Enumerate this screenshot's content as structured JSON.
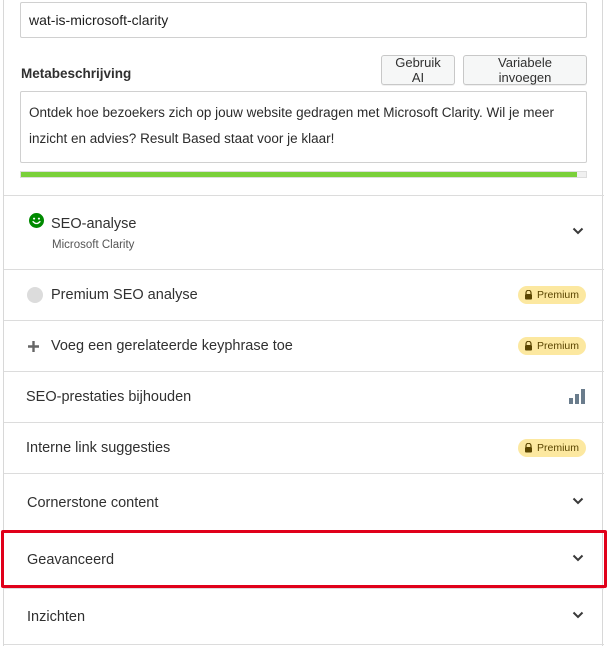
{
  "slug": {
    "value": "wat-is-microsoft-clarity"
  },
  "meta": {
    "label": "Metabeschrijving",
    "use_ai_button": "Gebruik AI",
    "insert_variable_button": "Variabele invoegen",
    "description": "Ontdek hoe bezoekers zich op jouw website gedragen met Microsoft Clarity. Wil je meer inzicht en advies? Result Based staat voor je klaar!",
    "length_progress": 0.984
  },
  "sections": {
    "seo_analysis": {
      "title": "SEO-analyse",
      "subtitle": "Microsoft Clarity",
      "status_icon": "smiley-icon",
      "status_color": "#008a00"
    },
    "premium_seo": {
      "title": "Premium SEO analyse",
      "badge": "Premium"
    },
    "related_keyphrase": {
      "title": "Voeg een gerelateerde keyphrase toe",
      "badge": "Premium"
    },
    "seo_performance": {
      "title": "SEO-prestaties bijhouden",
      "icon": "bar-chart-icon"
    },
    "internal_links": {
      "title": "Interne link suggesties",
      "badge": "Premium"
    },
    "cornerstone": {
      "title": "Cornerstone content"
    },
    "advanced": {
      "title": "Geavanceerd"
    },
    "insights": {
      "title": "Inzichten"
    }
  },
  "colors": {
    "progress": "#7ad03a",
    "badge_bg": "#fce8a0",
    "highlight": "#e0001a"
  }
}
